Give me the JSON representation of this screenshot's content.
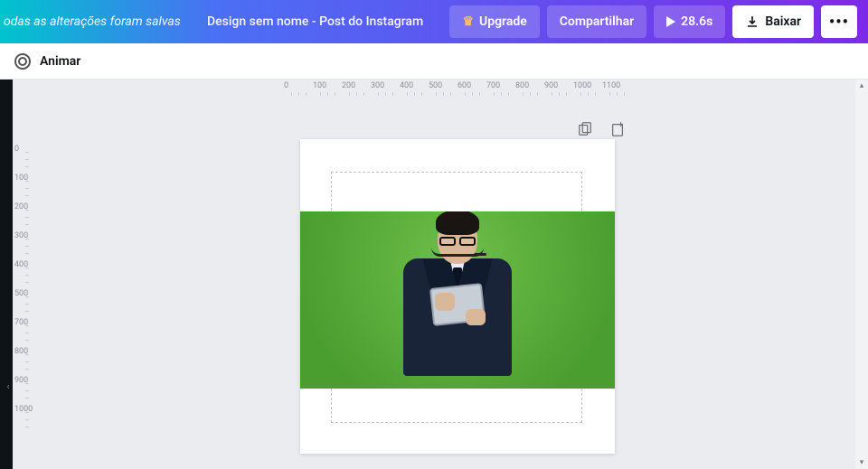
{
  "header": {
    "save_status": "odas as alterações foram salvas",
    "doc_title": "Design sem nome - Post do Instagram",
    "upgrade_label": "Upgrade",
    "share_label": "Compartilhar",
    "duration_label": "28.6s",
    "download_label": "Baixar"
  },
  "toolbar": {
    "animate_label": "Animar"
  },
  "ruler": {
    "h_ticks": [
      "0",
      "100",
      "200",
      "300",
      "400",
      "500",
      "600",
      "700",
      "800",
      "900",
      "1000",
      "1100"
    ],
    "v_ticks": [
      "0",
      "100",
      "200",
      "300",
      "400",
      "500",
      "700",
      "800",
      "900",
      "1000"
    ]
  },
  "canvas": {
    "content_description": "Man in dark suit with glasses and headset holding a tablet, green-screen background"
  }
}
